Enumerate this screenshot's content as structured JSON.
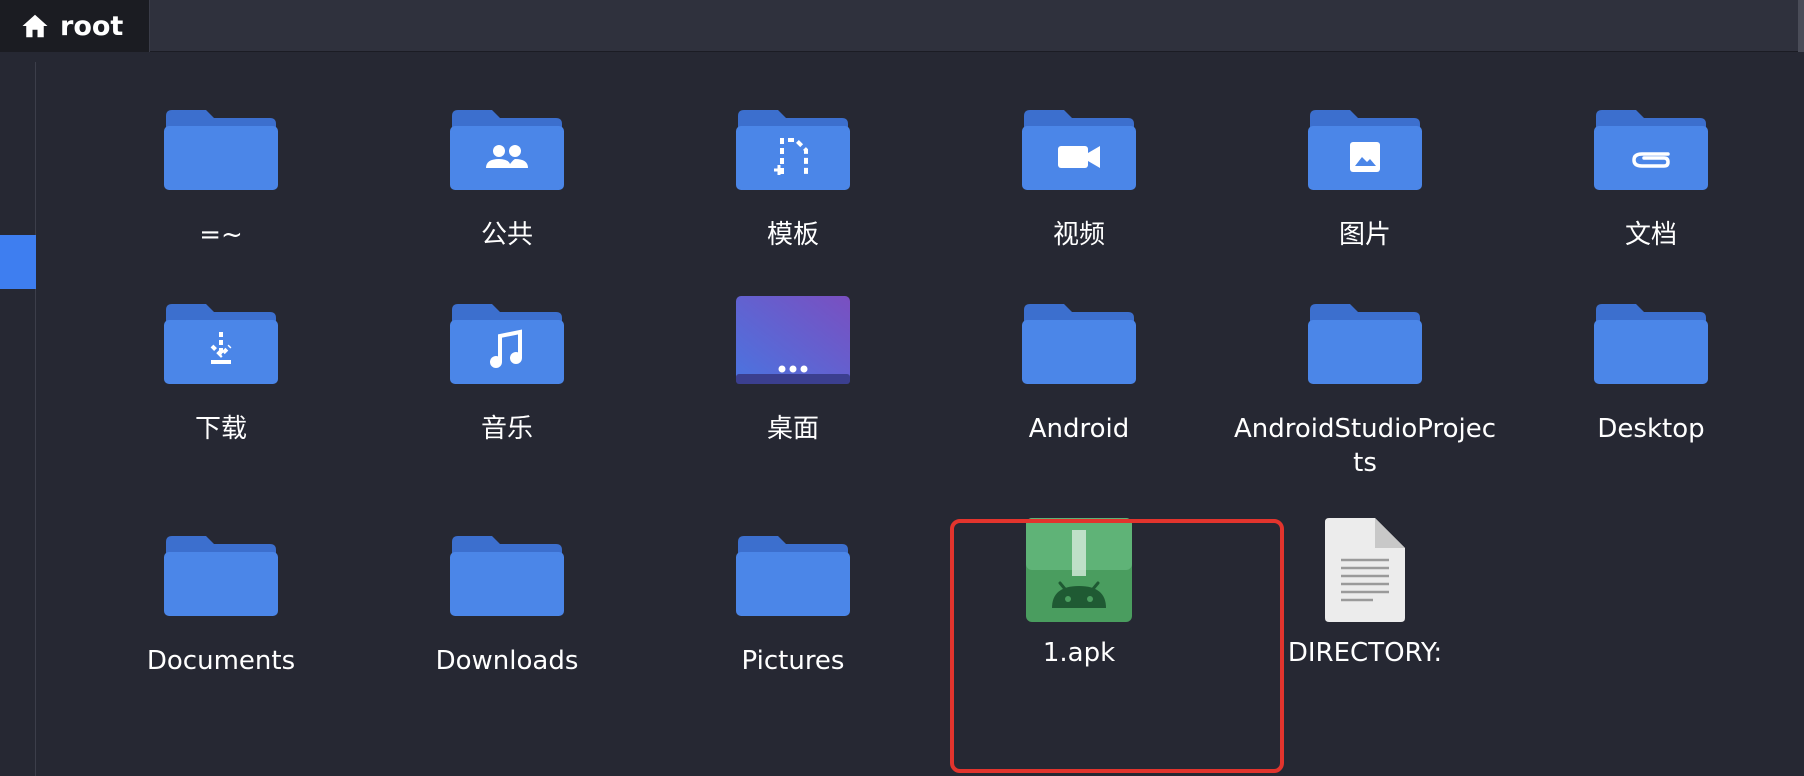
{
  "pathbar": {
    "crumb_label": "root",
    "crumb_icon": "home-icon"
  },
  "colors": {
    "folder": "#4b86e8",
    "folder_tab": "#3c6fce",
    "selection": "#3e7ef0",
    "highlight": "#e2342d",
    "apk_green": "#4a9d5f"
  },
  "items": [
    {
      "label": "=~",
      "icon": "folder-icon",
      "emblem": "none"
    },
    {
      "label": "公共",
      "icon": "folder-icon",
      "emblem": "people"
    },
    {
      "label": "模板",
      "icon": "folder-icon",
      "emblem": "template"
    },
    {
      "label": "视频",
      "icon": "folder-icon",
      "emblem": "video"
    },
    {
      "label": "图片",
      "icon": "folder-icon",
      "emblem": "picture"
    },
    {
      "label": "文档",
      "icon": "folder-icon",
      "emblem": "attachment"
    },
    {
      "label": "下载",
      "icon": "folder-icon",
      "emblem": "download"
    },
    {
      "label": "音乐",
      "icon": "folder-icon",
      "emblem": "music"
    },
    {
      "label": "桌面",
      "icon": "desktop-folder-icon",
      "emblem": "desktop"
    },
    {
      "label": "Android",
      "icon": "folder-icon",
      "emblem": "none"
    },
    {
      "label": "AndroidStudioProjects",
      "icon": "folder-icon",
      "emblem": "none"
    },
    {
      "label": "Desktop",
      "icon": "folder-icon",
      "emblem": "none"
    },
    {
      "label": "Documents",
      "icon": "folder-icon",
      "emblem": "none"
    },
    {
      "label": "Downloads",
      "icon": "folder-icon",
      "emblem": "none"
    },
    {
      "label": "Pictures",
      "icon": "folder-icon",
      "emblem": "none"
    },
    {
      "label": "1.apk",
      "icon": "apk-file-icon",
      "emblem": "android"
    },
    {
      "label": "DIRECTORY:",
      "icon": "text-file-icon",
      "emblem": "none"
    }
  ]
}
